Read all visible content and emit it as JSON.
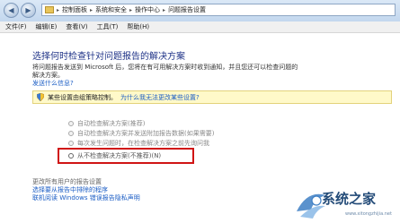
{
  "address": {
    "crumbs": [
      "控制面板",
      "系统和安全",
      "操作中心",
      "问题报告设置"
    ]
  },
  "menu": [
    "文件(F)",
    "编辑(E)",
    "查看(V)",
    "工具(T)",
    "帮助(H)"
  ],
  "main": {
    "title": "选择何时检查针对问题报告的解决方案",
    "desc_line1": "将问题报告发送到 Microsoft 后，您将在有可用解决方案时收到通知，并且您还可以检查问题的",
    "desc_line2": "解决方案。",
    "privacy_link": "发送什么信息?",
    "info_text": "某些设置由组策略控制。",
    "info_link": "为什么我无法更改某些设置?",
    "options": [
      "自动检查解决方案(推荐)",
      "自动检查解决方案并发送附加报告数据(如果需要)",
      "每次发生问题时，在检查解决方案之前先询问我",
      "从不检查解决方案(不推荐)(N)"
    ],
    "see_also": "更改所有用户的报告设置",
    "links": [
      "选择要从报告中排除的程序",
      "联机阅读 Windows 错误报告隐私声明"
    ]
  },
  "watermark": {
    "brand": "系统之家",
    "url": "www.xitongzhijia.net"
  },
  "colors": {
    "accent": "#1e3287",
    "link": "#1c5ec5",
    "highlight": "#d01414",
    "info_bg": "#fff9c9"
  }
}
